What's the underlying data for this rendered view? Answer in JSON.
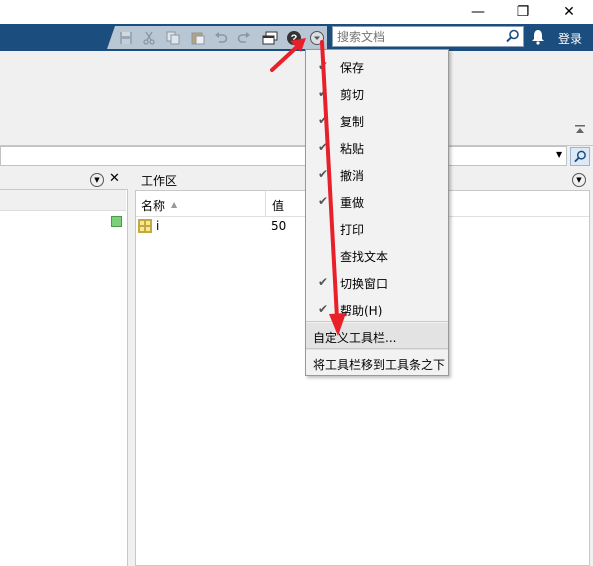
{
  "window": {
    "minimize_glyph": "—",
    "restore_glyph": "❐",
    "close_glyph": "✕"
  },
  "toolbar": {
    "search_placeholder": "搜索文档",
    "login_label": "登录",
    "icons": [
      "save-icon",
      "cut-icon",
      "copy-icon",
      "paste-icon",
      "undo-icon",
      "redo-icon",
      "switch-window-icon",
      "help-icon",
      "customize-dropdown-icon"
    ]
  },
  "left_panel": {
    "menu_glyph": "▼",
    "close_glyph": "✕"
  },
  "workspace": {
    "title": "工作区",
    "menu_glyph": "▼",
    "columns": {
      "name": "名称",
      "value": "值"
    },
    "sort_glyph": "▲",
    "rows": [
      {
        "name": "i",
        "value": "50"
      }
    ]
  },
  "menu": {
    "items": [
      {
        "label": "保存",
        "checked": true
      },
      {
        "label": "剪切",
        "checked": true
      },
      {
        "label": "复制",
        "checked": true
      },
      {
        "label": "粘贴",
        "checked": true
      },
      {
        "label": "撤消",
        "checked": true
      },
      {
        "label": "重做",
        "checked": true
      },
      {
        "label": "打印",
        "checked": false
      },
      {
        "label": "查找文本",
        "checked": false
      },
      {
        "label": "切换窗口",
        "checked": true
      },
      {
        "label": "帮助(H)",
        "checked": true
      }
    ],
    "customize": "自定义工具栏...",
    "move_below": "将工具栏移到工具条之下",
    "check_glyph": "✔"
  },
  "colors": {
    "toolbar_blue": "#1b4d7e",
    "arrow_red": "#e8202a"
  }
}
